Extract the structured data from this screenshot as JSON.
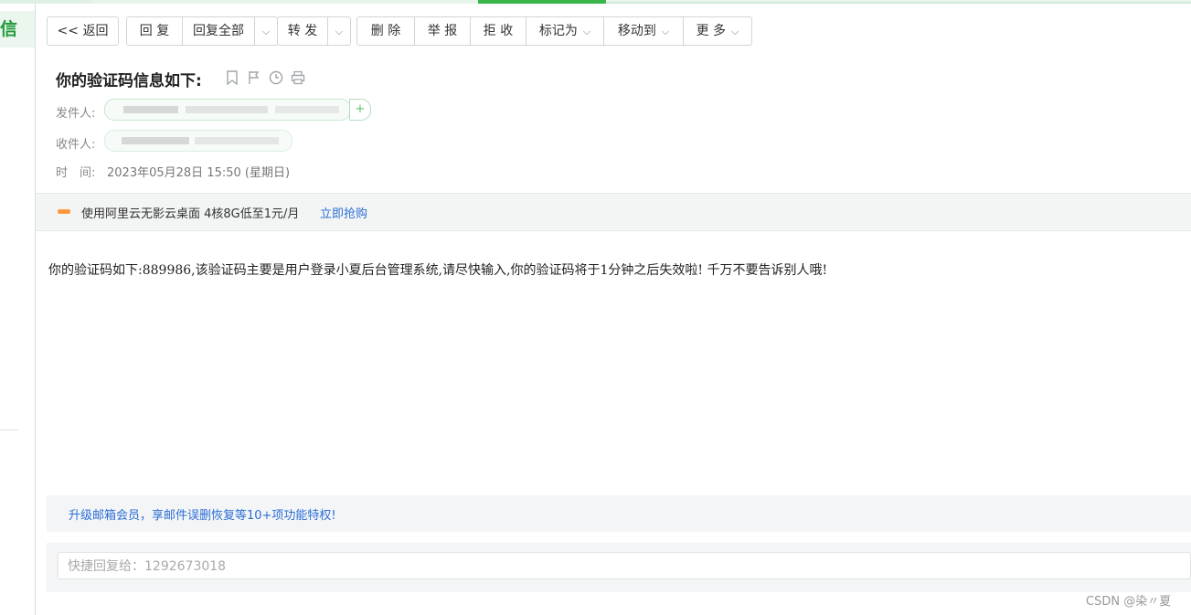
{
  "nav": {
    "brand_char": "信"
  },
  "toolbar": {
    "back": "<< 返回",
    "reply": "回 复",
    "reply_all": "回复全部",
    "forward": "转 发",
    "delete": "删 除",
    "report": "举 报",
    "reject": "拒 收",
    "mark_as": "标记为",
    "move_to": "移动到",
    "more": "更 多"
  },
  "mail": {
    "subject": "你的验证码信息如下:",
    "sender_label": "发件人:",
    "recipient_label": "收件人:",
    "time_label": "时　间:",
    "time_value": "2023年05月28日 15:50 (星期日)",
    "body": "你的验证码如下:889986,该验证码主要是用户登录小夏后台管理系统,请尽快输入,你的验证码将于1分钟之后失效啦! 千万不要告诉别人哦!"
  },
  "icons": [
    "bookmark-icon",
    "flag-icon",
    "clock-icon",
    "print-icon",
    "plus-icon",
    "chevron-down-icon"
  ],
  "ad": {
    "text": "使用阿里云无影云桌面 4核8G低至1元/月",
    "link": "立即抢购"
  },
  "upgrade": {
    "text": "升级邮箱会员，享邮件误删恢复等10+项功能特权!"
  },
  "quick_reply": {
    "placeholder": "快捷回复给：1292673018"
  },
  "watermark": "CSDN @染〃夏",
  "colors": {
    "accent_green": "#39b54a",
    "link_blue": "#2b6fd6"
  }
}
